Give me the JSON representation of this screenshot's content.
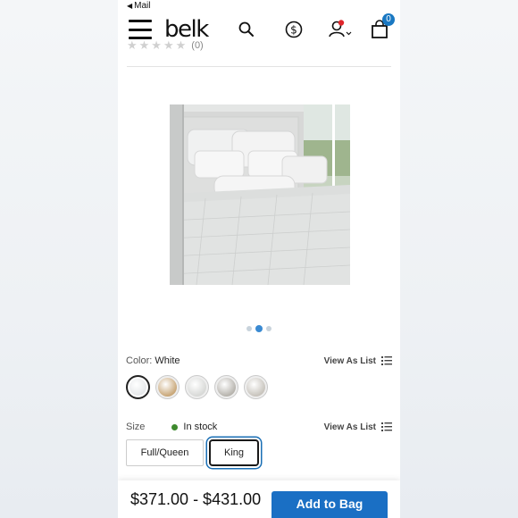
{
  "statusbar": {
    "back_glyph": "◀",
    "back_app": "Mail"
  },
  "header": {
    "logo": "belk",
    "icons": [
      "menu-icon",
      "search-icon",
      "dollar-icon",
      "account-icon",
      "bag-icon"
    ],
    "bag_count": "0"
  },
  "rating": {
    "stars": "★★★★★",
    "count": "(0)"
  },
  "carousel": {
    "total_slides": 3,
    "active_index": 1
  },
  "color": {
    "label": "Color:",
    "value": "White",
    "view_as_list": "View As List",
    "swatch_colors": [
      "#e6e8ea",
      "#c9a87a",
      "#d8d9d7",
      "#b7b4ae",
      "#c8c4bd"
    ]
  },
  "size": {
    "label": "Size",
    "stock": "In stock",
    "view_as_list": "View As List",
    "options": [
      "Full/Queen",
      "King"
    ],
    "selected": "King"
  },
  "purchase": {
    "price": "$371.00 - $431.00",
    "add_to_bag": "Add to Bag"
  },
  "colors": {
    "accent": "#1a6fc4",
    "stock": "#3e8a2e",
    "badge": "#1a78c2",
    "notify_dot": "#e0262b"
  }
}
